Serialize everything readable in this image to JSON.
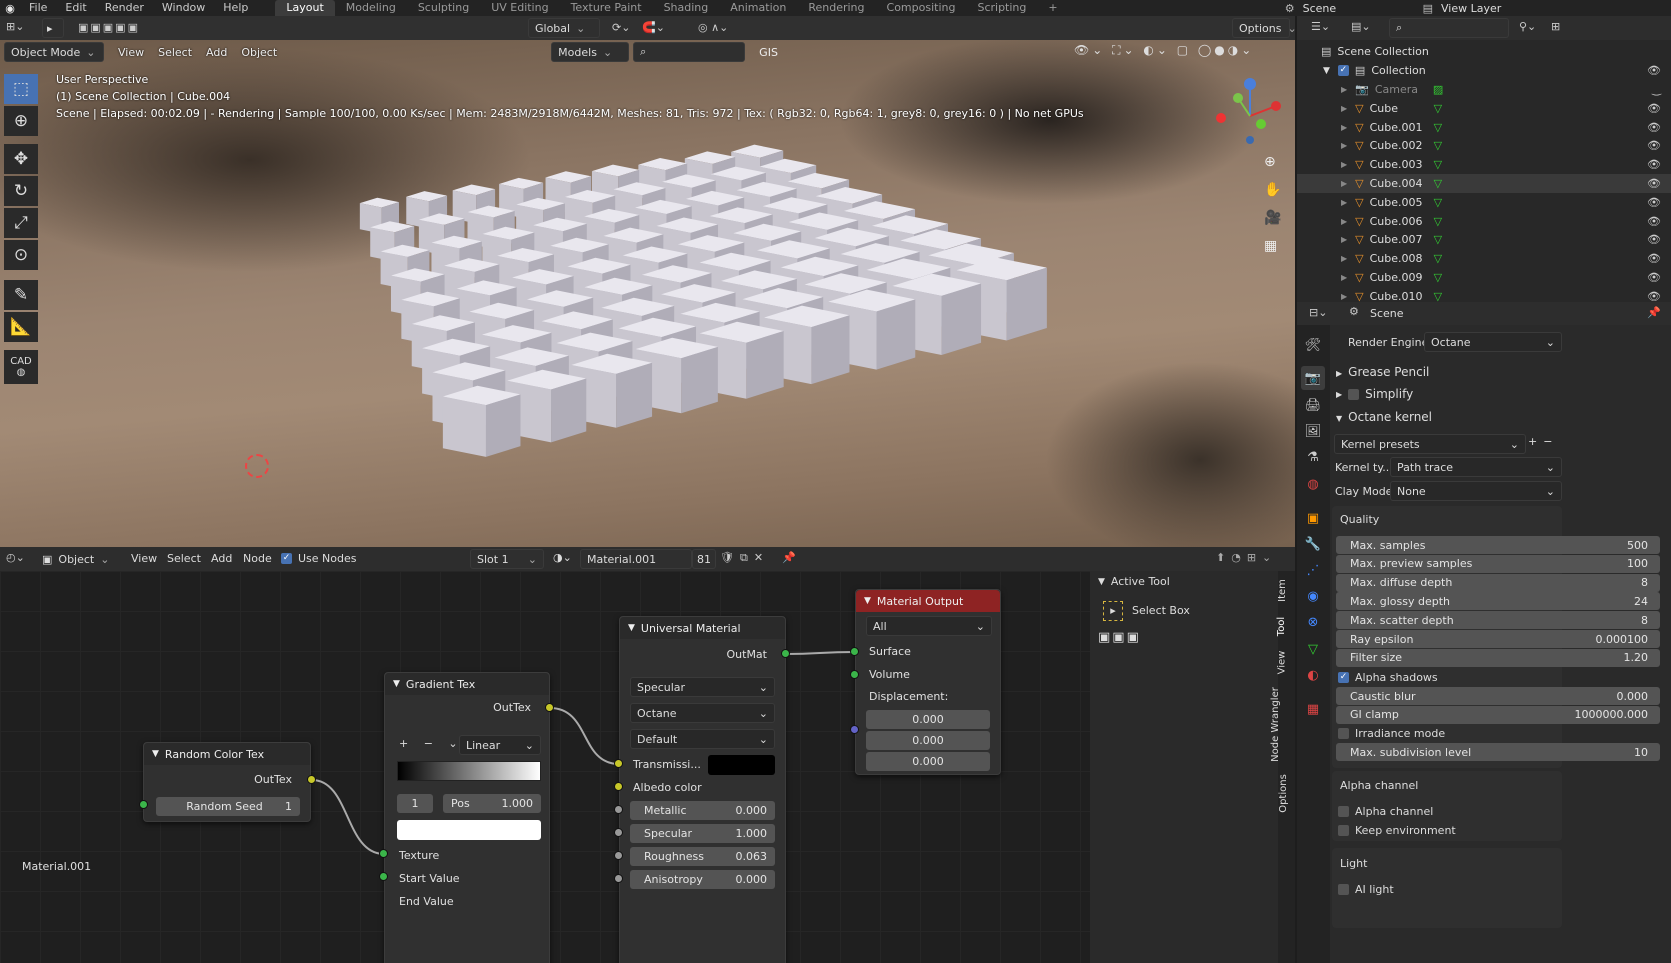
{
  "topbar": {
    "menus": [
      "File",
      "Edit",
      "Render",
      "Window",
      "Help"
    ],
    "workspaces": [
      "Layout",
      "Modeling",
      "Sculpting",
      "UV Editing",
      "Texture Paint",
      "Shading",
      "Animation",
      "Rendering",
      "Compositing",
      "Scripting"
    ],
    "active_workspace": "Layout",
    "plus": "+",
    "scene": "Scene",
    "view_layer": "View Layer"
  },
  "toolheader": {
    "orientation": "Global",
    "options": "Options"
  },
  "viewport_header": {
    "mode": "Object Mode",
    "menus": [
      "View",
      "Select",
      "Add",
      "Object"
    ],
    "models": "Models",
    "gis": "GIS"
  },
  "viewport": {
    "perspective": "User Perspective",
    "collection": "(1) Scene Collection | Cube.004",
    "status": "Scene | Elapsed: 00:02.09 | - Rendering | Sample 100/100, 0.00 Ks/sec | Mem: 2483M/2918M/6442M, Meshes: 81, Tris: 972 | Tex: ( Rgb32: 0, Rgb64: 1, grey8: 0, grey16: 0 ) | No net GPUs",
    "cube_rows": 9,
    "cube_cols": 9,
    "cad_label": "CAD"
  },
  "node_header": {
    "type": "Object",
    "menus": [
      "View",
      "Select",
      "Add",
      "Node"
    ],
    "use_nodes": "Use Nodes",
    "slot": "Slot 1",
    "material": "Material.001",
    "users": "81"
  },
  "nodes": {
    "random": {
      "title": "Random Color Tex",
      "out": "OutTex",
      "seed_label": "Random Seed",
      "seed": "1"
    },
    "gradient": {
      "title": "Gradient Tex",
      "out": "OutTex",
      "interp": "Linear",
      "idx": "1",
      "pos_label": "Pos",
      "pos": "1.000",
      "in1": "Texture",
      "in2": "Start Value",
      "in3": "End Value"
    },
    "universal": {
      "title": "Universal Material",
      "out": "OutMat",
      "d1": "Specular",
      "d2": "Octane",
      "d3": "Default",
      "trans": "Transmissi...",
      "albedo": "Albedo color",
      "metallic_l": "Metallic",
      "metallic": "0.000",
      "specular_l": "Specular",
      "specular": "1.000",
      "rough_l": "Roughness",
      "rough": "0.063",
      "aniso_l": "Anisotropy",
      "aniso": "0.000"
    },
    "output": {
      "title": "Material Output",
      "target": "All",
      "surface": "Surface",
      "volume": "Volume",
      "disp": "Displacement:",
      "v1": "0.000",
      "v2": "0.000",
      "v3": "0.000"
    }
  },
  "node_footer": "Material.001",
  "sidebar": {
    "title": "Active Tool",
    "tool": "Select Box",
    "tabs": [
      "Item",
      "Tool",
      "View",
      "Node Wrangler",
      "Options"
    ]
  },
  "outliner": {
    "root": "Scene Collection",
    "collection": "Collection",
    "items": [
      "Camera",
      "Cube",
      "Cube.001",
      "Cube.002",
      "Cube.003",
      "Cube.004",
      "Cube.005",
      "Cube.006",
      "Cube.007",
      "Cube.008",
      "Cube.009",
      "Cube.010"
    ]
  },
  "properties": {
    "scene": "Scene",
    "engine_label": "Render Engine",
    "engine": "Octane",
    "grease": "Grease Pencil",
    "simplify": "Simplify",
    "kernel": "Octane kernel",
    "presets": "Kernel presets",
    "ktype_label": "Kernel ty...",
    "ktype": "Path trace",
    "clay_label": "Clay Mode:",
    "clay": "None",
    "quality": "Quality",
    "rows": [
      [
        "Max. samples",
        "500"
      ],
      [
        "Max. preview samples",
        "100"
      ],
      [
        "Max. diffuse depth",
        "8"
      ],
      [
        "Max. glossy depth",
        "24"
      ],
      [
        "Max. scatter depth",
        "8"
      ],
      [
        "Ray epsilon",
        "0.000100"
      ],
      [
        "Filter size",
        "1.20"
      ]
    ],
    "alpha_shadows": "Alpha shadows",
    "rows2": [
      [
        "Caustic blur",
        "0.000"
      ],
      [
        "GI clamp",
        "1000000.000"
      ]
    ],
    "irradiance": "Irradiance mode",
    "maxsub_l": "Max. subdivision level",
    "maxsub": "10",
    "alpha_channel_h": "Alpha channel",
    "alpha_channel": "Alpha channel",
    "keep_env": "Keep environment",
    "light_h": "Light",
    "ai_light": "AI light"
  }
}
